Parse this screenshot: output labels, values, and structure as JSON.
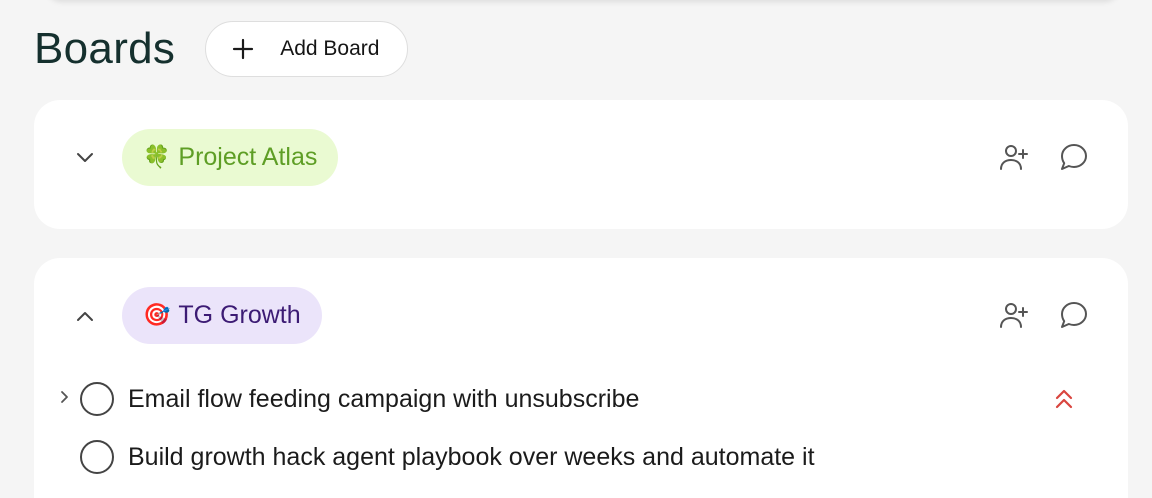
{
  "header": {
    "title": "Boards",
    "add_board_label": "Add Board"
  },
  "boards": [
    {
      "emoji": "🍀",
      "name": "Project Atlas",
      "color": "#5e9e25",
      "background": "#eafad2",
      "expanded": false,
      "icons": [
        "chevron-down-icon",
        "add-user-icon",
        "comment-icon"
      ]
    },
    {
      "emoji": "🎯",
      "name": "TG Growth",
      "color": "#3c1b74",
      "background": "#ebe4fa",
      "expanded": true,
      "icons": [
        "chevron-up-icon",
        "add-user-icon",
        "comment-icon"
      ],
      "tasks": [
        {
          "title": "Email flow feeding campaign with unsubscribe",
          "has_subtasks": true,
          "priority": "urgent",
          "priority_icon": "double-chevron-up-icon",
          "priority_color": "#d9453f"
        },
        {
          "title": "Build growth hack agent playbook over weeks and automate it",
          "has_subtasks": false
        }
      ]
    }
  ]
}
